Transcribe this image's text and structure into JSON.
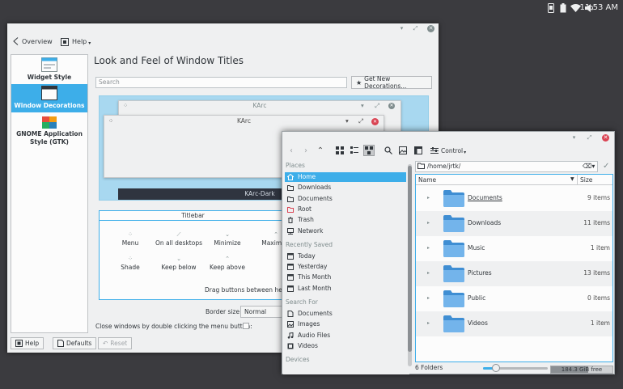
{
  "system_panel": {
    "clock": "11:53 AM",
    "icons": [
      "phone-icon",
      "battery-icon",
      "wifi-icon",
      "volume-icon"
    ]
  },
  "settings_window": {
    "toolbar": {
      "overview_label": "Overview",
      "help_label": "Help"
    },
    "sidebar": {
      "items": [
        {
          "label": "Widget Style",
          "icon": "widget-style-icon"
        },
        {
          "label": "Window Decorations",
          "icon": "window-decorations-icon",
          "selected": true
        },
        {
          "label": "GNOME Application Style (GTK)",
          "icon": "gtk-icon"
        }
      ]
    },
    "page_title": "Look and Feel of Window Titles",
    "search_placeholder": "Search",
    "get_new_label": "Get New Decorations...",
    "preview": {
      "window1_title": "KArc",
      "window2_title": "KArc",
      "window3_title": "KArc-Dark"
    },
    "titlebar_box": {
      "header": "Titlebar",
      "buttons": [
        {
          "label": "Menu",
          "icon": "menu-icon"
        },
        {
          "label": "On all desktops",
          "icon": "pin-icon"
        },
        {
          "label": "Minimize",
          "icon": "minimize-icon"
        },
        {
          "label": "Maximize",
          "icon": "maximize-icon"
        },
        {
          "label": "Shade",
          "icon": "shade-icon"
        },
        {
          "label": "Keep below",
          "icon": "keep-below-icon"
        },
        {
          "label": "Keep above",
          "icon": "keep-above-icon"
        }
      ],
      "hint": "Drag buttons between here a"
    },
    "border_size_label": "Border size:",
    "border_size_value": "Normal",
    "close_double_click_label": "Close windows by double clicking the menu button:",
    "close_double_click_checked": false,
    "bottom_buttons": {
      "help": "Help",
      "defaults": "Defaults",
      "reset": "Reset"
    }
  },
  "file_dialog": {
    "toolbar": {
      "control_label": "Control"
    },
    "places": {
      "sections": [
        {
          "title": "Places",
          "items": [
            {
              "label": "Home",
              "icon": "home-icon",
              "selected": true
            },
            {
              "label": "Downloads",
              "icon": "downloads-icon"
            },
            {
              "label": "Documents",
              "icon": "documents-icon"
            },
            {
              "label": "Root",
              "icon": "root-folder-icon"
            },
            {
              "label": "Trash",
              "icon": "trash-icon"
            },
            {
              "label": "Network",
              "icon": "network-icon"
            }
          ]
        },
        {
          "title": "Recently Saved",
          "items": [
            {
              "label": "Today",
              "icon": "calendar-icon"
            },
            {
              "label": "Yesterday",
              "icon": "calendar-icon"
            },
            {
              "label": "This Month",
              "icon": "calendar-icon"
            },
            {
              "label": "Last Month",
              "icon": "calendar-icon"
            }
          ]
        },
        {
          "title": "Search For",
          "items": [
            {
              "label": "Documents",
              "icon": "document-icon"
            },
            {
              "label": "Images",
              "icon": "image-icon"
            },
            {
              "label": "Audio Files",
              "icon": "audio-icon"
            },
            {
              "label": "Videos",
              "icon": "video-icon"
            }
          ]
        },
        {
          "title": "Devices",
          "items": []
        }
      ]
    },
    "path": "/home/jrtk/",
    "columns": {
      "name": "Name",
      "size": "Size"
    },
    "files": [
      {
        "name": "Documents",
        "count": "9 items",
        "hovered": true
      },
      {
        "name": "Downloads",
        "count": "11 items"
      },
      {
        "name": "Music",
        "count": "1 item"
      },
      {
        "name": "Pictures",
        "count": "13 items"
      },
      {
        "name": "Public",
        "count": "0 items"
      },
      {
        "name": "Videos",
        "count": "1 item"
      }
    ],
    "status": "6 Folders",
    "free_space": "184.3 GiB free",
    "zoom_level": 0.2,
    "disk_used_fraction": 0.6
  },
  "colors": {
    "accent": "#3daee9",
    "window_bg": "#eff0f1",
    "view_bg": "#fcfcfc",
    "close_red": "#da4453"
  }
}
